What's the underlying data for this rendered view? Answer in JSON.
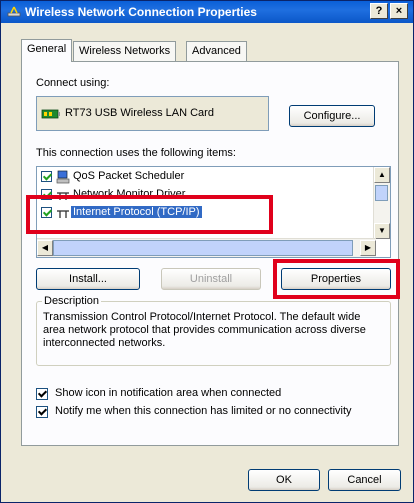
{
  "window": {
    "title": "Wireless Network Connection Properties",
    "help_label": "?",
    "close_label": "×"
  },
  "tabs": [
    {
      "label": "General"
    },
    {
      "label": "Wireless Networks"
    },
    {
      "label": "Advanced"
    }
  ],
  "general": {
    "connect_using_label": "Connect using:",
    "adapter_name": "RT73 USB Wireless LAN Card",
    "configure_label": "Configure...",
    "items_label": "This connection uses the following items:",
    "items": [
      {
        "label": "QoS Packet Scheduler",
        "checked": true,
        "icon": "qos-icon"
      },
      {
        "label": "Network Monitor Driver",
        "checked": true,
        "icon": "network-protocol-icon"
      },
      {
        "label": "Internet Protocol (TCP/IP)",
        "checked": true,
        "icon": "network-protocol-icon",
        "selected": true
      }
    ],
    "install_label": "Install...",
    "uninstall_label": "Uninstall",
    "properties_label": "Properties",
    "description_title": "Description",
    "description_text": "Transmission Control Protocol/Internet Protocol. The default wide area network protocol that provides communication across diverse interconnected networks.",
    "show_icon_label": "Show icon in notification area when connected",
    "show_icon_checked": true,
    "notify_label": "Notify me when this connection has limited or no connectivity",
    "notify_checked": true
  },
  "footer": {
    "ok_label": "OK",
    "cancel_label": "Cancel"
  },
  "colors": {
    "titlebar": "#0a5fd8",
    "highlight": "#316ac5",
    "annotation_red": "#e0001b"
  }
}
